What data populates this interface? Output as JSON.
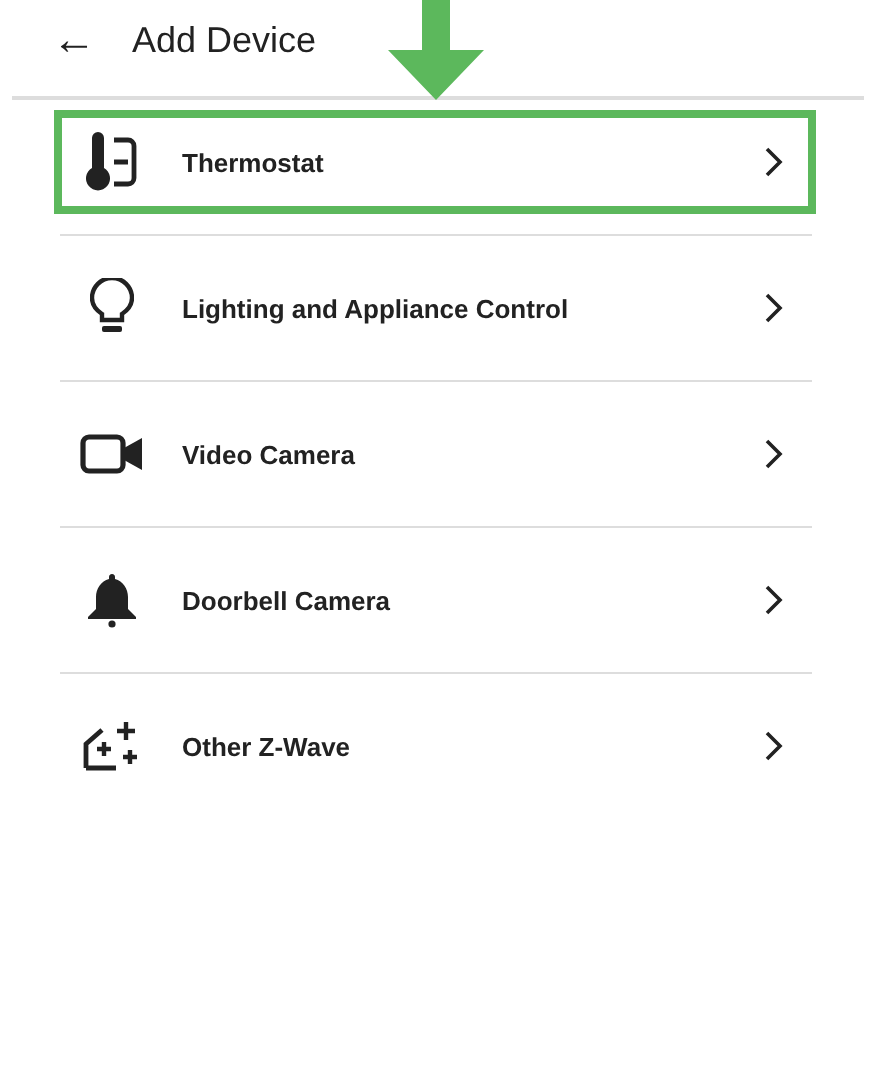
{
  "header": {
    "back_icon": "←",
    "title": "Add Device"
  },
  "devices": [
    {
      "kind": "thermostat",
      "label": "Thermostat",
      "highlighted": true
    },
    {
      "kind": "bulb",
      "label": "Lighting and Appliance Control",
      "highlighted": false
    },
    {
      "kind": "camera",
      "label": "Video Camera",
      "highlighted": false
    },
    {
      "kind": "bell",
      "label": "Doorbell Camera",
      "highlighted": false
    },
    {
      "kind": "zwave",
      "label": "Other Z-Wave",
      "highlighted": false
    }
  ]
}
